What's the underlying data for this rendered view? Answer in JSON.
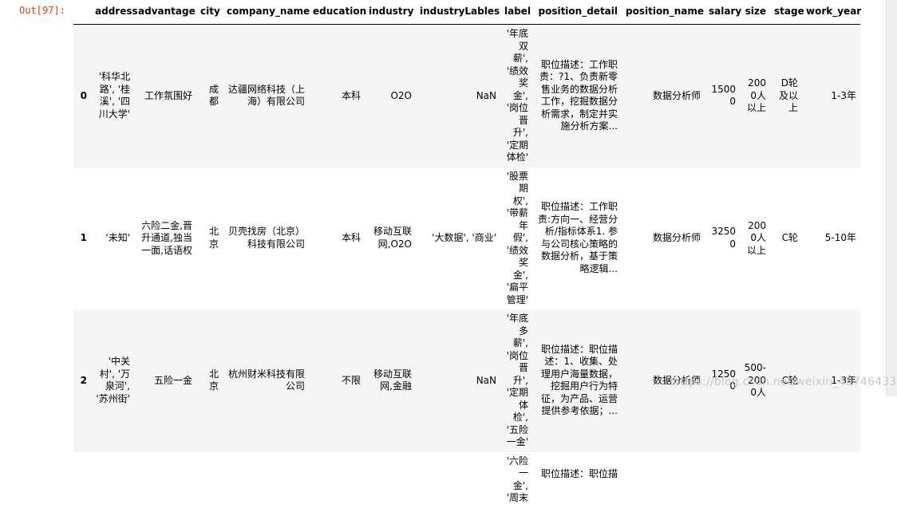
{
  "prompt": "Out[97]:",
  "columns": [
    "address",
    "advantage",
    "city",
    "company_name",
    "education",
    "industry",
    "industryLables",
    "label",
    "position_detail",
    "position_name",
    "salary",
    "size",
    "stage",
    "work_year"
  ],
  "rows": [
    {
      "index": "0",
      "address": "'科华北路', '桂溪', '四川大学'",
      "advantage": "工作氛围好",
      "city": "成都",
      "company_name": "达疆网络科技（上海）有限公司",
      "education": "本科",
      "industry": "O2O",
      "industryLables": "NaN",
      "label": "'年底双薪', '绩效奖金', '岗位晋升', '定期体检'",
      "position_detail": "职位描述：工作职责：?1、负责新零售业务的数据分析工作，挖掘数据分析需求，制定并实施分析方案...",
      "position_name": "数据分析师",
      "salary": "15000",
      "size": "2000人以上",
      "stage": "D轮及以上",
      "work_year": "1-3年"
    },
    {
      "index": "1",
      "address": "'未知'",
      "advantage": "六险二金,晋升通道,独当一面,话语权",
      "city": "北京",
      "company_name": "贝壳找房（北京）科技有限公司",
      "education": "本科",
      "industry": "移动互联网,O2O",
      "industryLables": "'大数据', '商业'",
      "label": "'股票期权', '带薪年假', '绩效奖金', '扁平管理'",
      "position_detail": "职位描述：工作职责:方向一、经营分析/指标体系1. 参与公司核心策略的数据分析，基于策略逻辑...",
      "position_name": "数据分析师",
      "salary": "32500",
      "size": "2000人以上",
      "stage": "C轮",
      "work_year": "5-10年"
    },
    {
      "index": "2",
      "address": "'中关村', '万泉河', '苏州街'",
      "advantage": "五险一金",
      "city": "北京",
      "company_name": "杭州财米科技有限公司",
      "education": "不限",
      "industry": "移动互联网,金融",
      "industryLables": "NaN",
      "label": "'年底多薪', '岗位晋升', '定期体检', '五险一金'",
      "position_detail": "职位描述：职位描述：1、收集、处理用户海量数据，挖掘用户行为特征，为产品、运营提供参考依据；...",
      "position_name": "数据分析师",
      "salary": "12500",
      "size": "500-2000人",
      "stage": "C轮",
      "work_year": "1-3年"
    },
    {
      "index": "",
      "address": "",
      "advantage": "",
      "city": "",
      "company_name": "",
      "education": "",
      "industry": "",
      "industryLables": "",
      "label": "'六险一金', '周末",
      "position_detail": "职位描述：职位描",
      "position_name": "",
      "salary": "",
      "size": "",
      "stage": "",
      "work_year": ""
    }
  ],
  "watermark": "https://blog.csdn.net/weixin_43746433"
}
